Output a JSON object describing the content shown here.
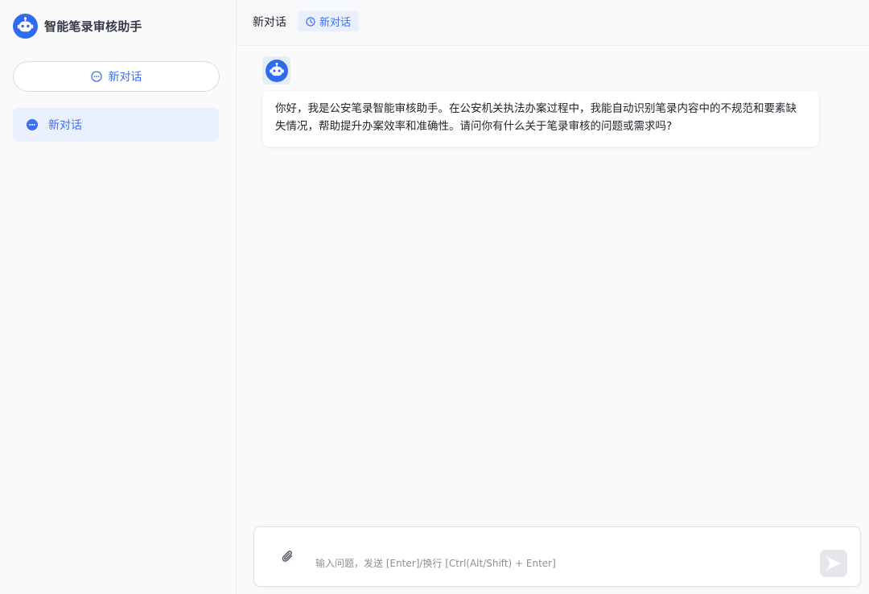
{
  "app": {
    "title": "智能笔录审核助手"
  },
  "sidebar": {
    "new_chat_label": "新对话",
    "conversations": [
      {
        "label": "新对话",
        "active": true
      }
    ]
  },
  "header": {
    "title": "新对话",
    "history_tag": "新对话"
  },
  "messages": [
    {
      "role": "assistant",
      "text": "你好，我是公安笔录智能审核助手。在公安机关执法办案过程中，我能自动识别笔录内容中的不规范和要素缺失情况，帮助提升办案效率和准确性。请问你有什么关于笔录审核的问题或需求吗?"
    }
  ],
  "composer": {
    "placeholder": "输入问题，发送 [Enter]/换行 [Ctrl(Alt/Shift) + Enter]"
  },
  "icons": {
    "logo": "robot-icon",
    "new_chat": "chat-bubble-icon",
    "conversation": "chat-dots-icon",
    "history": "clock-icon",
    "attach": "paperclip-icon",
    "send": "send-icon"
  },
  "colors": {
    "accent": "#3b6ff5",
    "active_bg": "#eaf0fd",
    "send_disabled": "#e4e6ea"
  }
}
